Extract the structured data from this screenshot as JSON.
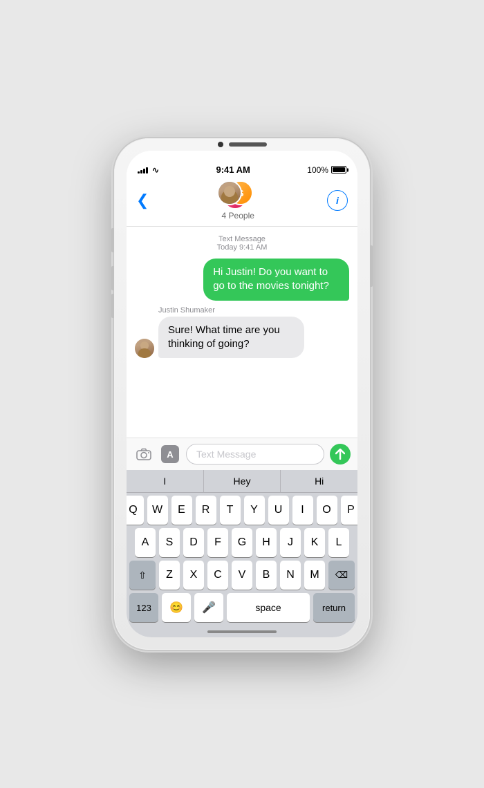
{
  "phone": {
    "status": {
      "time": "9:41 AM",
      "battery_label": "100%",
      "signal_bars": [
        3,
        5,
        7,
        9,
        11
      ],
      "wifi": "WiFi"
    },
    "nav": {
      "back_label": "<",
      "group_label": "4 People",
      "info_label": "i"
    },
    "messages": {
      "meta_label": "Text Message",
      "meta_time": "Today 9:41 AM",
      "sent_bubble": "Hi Justin! Do you want to go to the movies tonight?",
      "sender_name": "Justin Shumaker",
      "received_bubble": "Sure! What time are you thinking of going?"
    },
    "input": {
      "placeholder": "Text Message",
      "camera_icon": "📷",
      "app_icon": "A",
      "send_icon": "↑"
    },
    "autocomplete": {
      "items": [
        "I",
        "Hey",
        "Hi"
      ]
    },
    "keyboard": {
      "row1": [
        "Q",
        "W",
        "E",
        "R",
        "T",
        "Y",
        "U",
        "I",
        "O",
        "P"
      ],
      "row2": [
        "A",
        "S",
        "D",
        "F",
        "G",
        "H",
        "J",
        "K",
        "L"
      ],
      "row3": [
        "Z",
        "X",
        "C",
        "V",
        "B",
        "N",
        "M"
      ],
      "bottom": [
        "123",
        "😊",
        "🎤",
        "space",
        "return"
      ]
    }
  }
}
